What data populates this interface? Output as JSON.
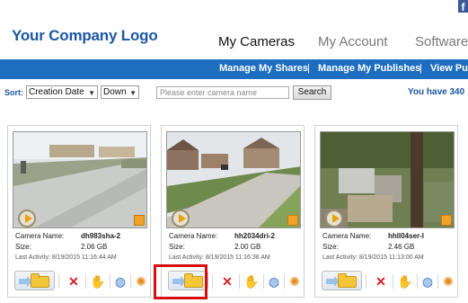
{
  "header": {
    "logo": "Your Company Logo",
    "facebook_icon": "facebook-icon",
    "nav": [
      "My Cameras",
      "My Account",
      "Software"
    ],
    "active_nav": "My Cameras"
  },
  "subnav": {
    "links": [
      "Manage My Shares",
      "Manage My Publishes",
      "View Pub"
    ],
    "separator": "|"
  },
  "toolbar": {
    "sort_label": "Sort:",
    "sort_field": "Creation Date",
    "sort_direction": "Down",
    "search_placeholder": "Please enter camera name",
    "search_button": "Search",
    "status_text": "You have 340"
  },
  "cameras": [
    {
      "name_label": "Camera Name:",
      "name": "dh983sha-2",
      "size_label": "Size:",
      "size": "2.06 GB",
      "last_activity": "Last Activity:   8/19/2015 11:16:44 AM"
    },
    {
      "name_label": "Camera Name:",
      "name": "hh2034dri-2",
      "size_label": "Size:",
      "size": "2.00 GB",
      "last_activity": "Last Activity:   8/19/2015 11:16:38 AM"
    },
    {
      "name_label": "Camera Name:",
      "name": "hhll04ser-l",
      "size_label": "Size:",
      "size": "2.46 GB",
      "last_activity": "Last Activity:   8/19/2015 11:13:00 AM"
    }
  ],
  "action_icons": [
    "folder-icon",
    "delete-icon",
    "share-hand-icon",
    "globe-icon",
    "gear-icon"
  ],
  "colors": {
    "brand_blue": "#1e6ec0",
    "logo_blue": "#1b57a3",
    "highlight_red": "#d60f0f",
    "play_orange": "#e8a20b"
  }
}
